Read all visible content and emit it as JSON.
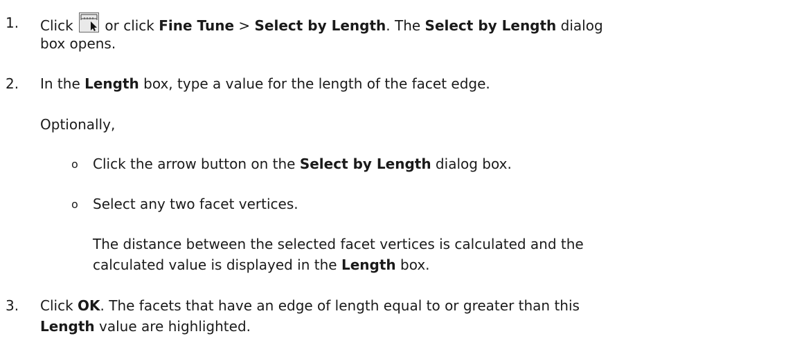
{
  "steps": [
    {
      "number": "1.",
      "before_icon": "Click",
      "icon": "select-by-length-tool-icon",
      "after_icon": " or click ",
      "menu": "Fine Tune",
      "sep": " > ",
      "item": "Select by Length",
      "mid": ". The ",
      "dialog": "Select by Length",
      "end": " dialog",
      "line2": "box opens."
    },
    {
      "number": "2.",
      "pre": "In the ",
      "field": "Length",
      "post": " box, type a value for the length of the facet edge.",
      "optional": "Optionally,",
      "bullets": [
        {
          "pre": "Click the arrow button on the ",
          "bold": "Select by Length",
          "post": " dialog box."
        },
        {
          "text": "Select any two facet vertices."
        }
      ],
      "note_line1": "The distance between the selected facet vertices is calculated and the",
      "note_line2_pre": "calculated value is displayed in the ",
      "note_line2_bold": "Length",
      "note_line2_post": " box."
    },
    {
      "number": "3.",
      "pre": "Click ",
      "ok": "OK",
      "post": ". The facets that have an edge of length equal to or greater than this",
      "line2_bold": "Length",
      "line2_post": " value are highlighted."
    }
  ],
  "bullet_glyph": "o",
  "colors": {
    "text": "#1a1a1a",
    "background": "#ffffff"
  }
}
